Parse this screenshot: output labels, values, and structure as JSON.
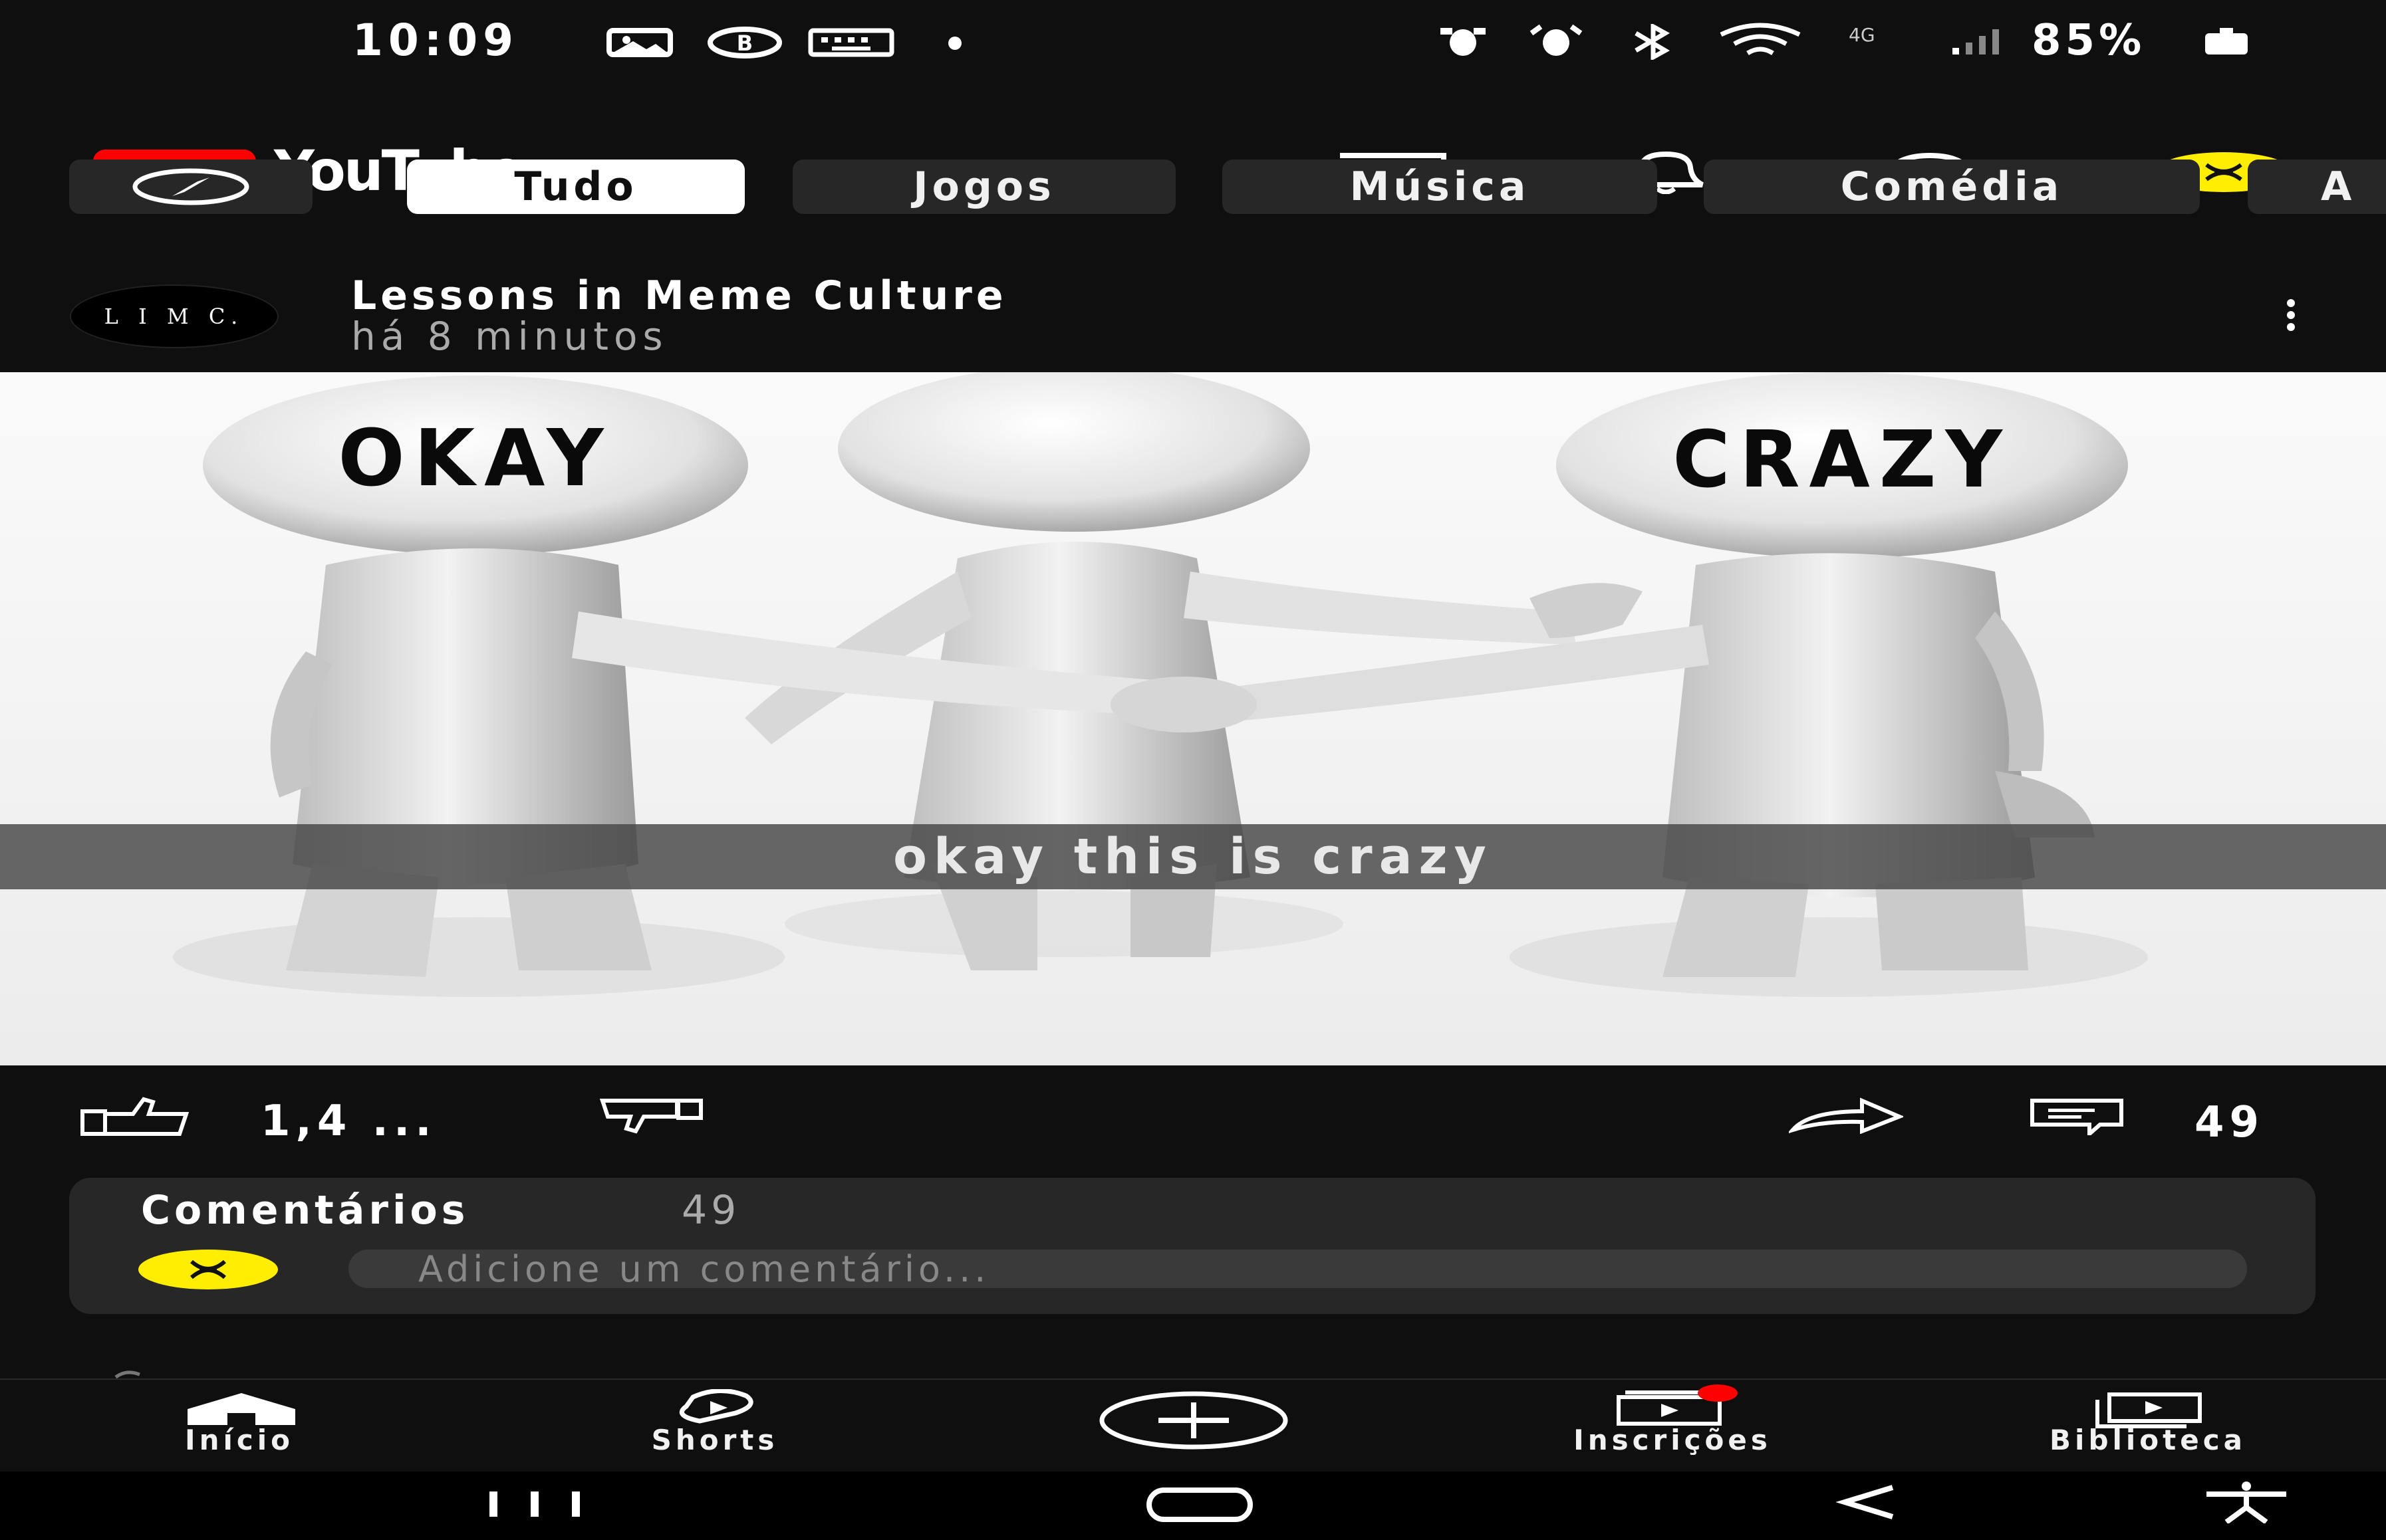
{
  "status_bar": {
    "time": "10:09",
    "battery": "85%",
    "network": "4G"
  },
  "header": {
    "brand": "YouTube",
    "brand_color": "#ff0000",
    "icons": [
      "cast-icon",
      "bell-icon",
      "search-icon",
      "account-avatar"
    ]
  },
  "chips": [
    {
      "label": ""
    },
    {
      "label": "Tudo"
    },
    {
      "label": "Jogos"
    },
    {
      "label": "Música"
    },
    {
      "label": "Comédia"
    },
    {
      "label": "A"
    }
  ],
  "post": {
    "channel_avatar_text": "L I M C.",
    "channel_name": "Lessons in Meme Culture",
    "time_ago": "há 8 minutos",
    "image": {
      "left_label": "OKAY",
      "right_label": "CRAZY",
      "caption": "okay this is crazy"
    }
  },
  "actions": {
    "likes": "1,4 ...",
    "comments_count": "49"
  },
  "comments": {
    "title": "Comentários",
    "count": "49",
    "placeholder": "Adicione um comentário..."
  },
  "bottom_nav": [
    {
      "label": "Início"
    },
    {
      "label": "Shorts"
    },
    {
      "label": ""
    },
    {
      "label": "Inscrições"
    },
    {
      "label": "Biblioteca"
    }
  ]
}
